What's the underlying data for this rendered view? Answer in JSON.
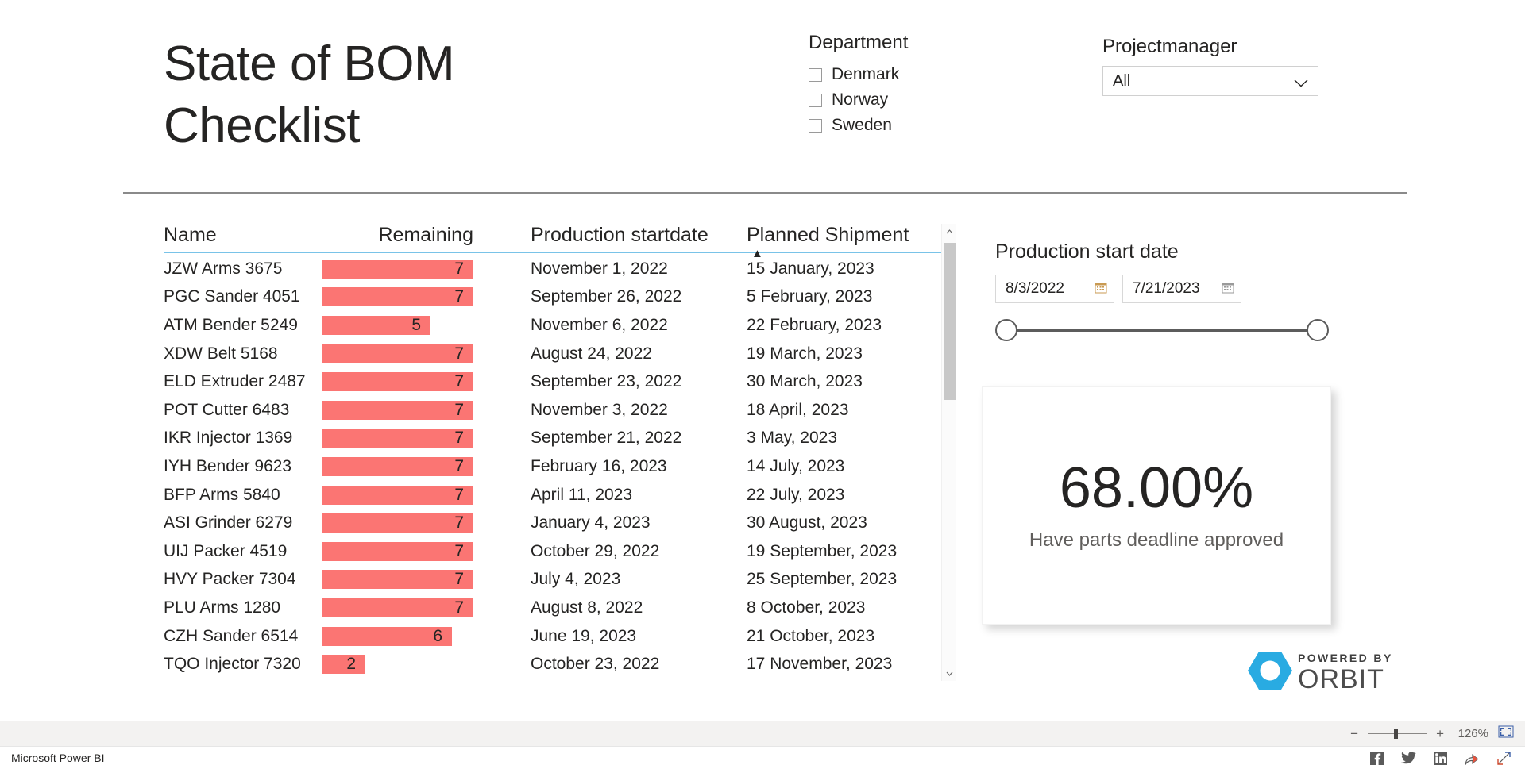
{
  "page_title": "State of BOM\nChecklist",
  "department_slicer": {
    "title": "Department",
    "options": [
      {
        "label": "Denmark",
        "checked": false
      },
      {
        "label": "Norway",
        "checked": false
      },
      {
        "label": "Sweden",
        "checked": false
      }
    ]
  },
  "projectmanager_slicer": {
    "title": "Projectmanager",
    "selected": "All",
    "icon": "chevron-down-icon"
  },
  "table": {
    "columns": [
      "Name",
      "Remaining",
      "Production startdate",
      "Planned Shipment"
    ],
    "sorted_column": "Planned Shipment",
    "sort_direction": "ascending",
    "sort_glyph": "▲",
    "bar_color": "#fb7573",
    "header_rule_color": "#79c3e8",
    "max_remaining": 7,
    "rows": [
      {
        "name": "JZW Arms 3675",
        "remaining": 7,
        "start": "November 1, 2022",
        "shipment": "15 January, 2023"
      },
      {
        "name": "PGC Sander 4051",
        "remaining": 7,
        "start": "September 26, 2022",
        "shipment": "5 February, 2023"
      },
      {
        "name": "ATM Bender 5249",
        "remaining": 5,
        "start": "November 6, 2022",
        "shipment": "22 February, 2023"
      },
      {
        "name": "XDW Belt 5168",
        "remaining": 7,
        "start": "August 24, 2022",
        "shipment": "19 March, 2023"
      },
      {
        "name": "ELD Extruder 2487",
        "remaining": 7,
        "start": "September 23, 2022",
        "shipment": "30 March, 2023"
      },
      {
        "name": "POT Cutter 6483",
        "remaining": 7,
        "start": "November 3, 2022",
        "shipment": "18 April, 2023"
      },
      {
        "name": "IKR Injector 1369",
        "remaining": 7,
        "start": "September 21, 2022",
        "shipment": "3 May, 2023"
      },
      {
        "name": "IYH Bender 9623",
        "remaining": 7,
        "start": "February 16, 2023",
        "shipment": "14 July, 2023"
      },
      {
        "name": "BFP Arms 5840",
        "remaining": 7,
        "start": "April 11, 2023",
        "shipment": "22 July, 2023"
      },
      {
        "name": "ASI Grinder 6279",
        "remaining": 7,
        "start": "January 4, 2023",
        "shipment": "30 August, 2023"
      },
      {
        "name": "UIJ Packer 4519",
        "remaining": 7,
        "start": "October 29, 2022",
        "shipment": "19 September, 2023"
      },
      {
        "name": "HVY Packer 7304",
        "remaining": 7,
        "start": "July 4, 2023",
        "shipment": "25 September, 2023"
      },
      {
        "name": "PLU Arms 1280",
        "remaining": 7,
        "start": "August 8, 2022",
        "shipment": "8 October, 2023"
      },
      {
        "name": "CZH Sander 6514",
        "remaining": 6,
        "start": "June 19, 2023",
        "shipment": "21 October, 2023"
      },
      {
        "name": "TQO Injector 7320",
        "remaining": 2,
        "start": "October 23, 2022",
        "shipment": "17 November, 2023"
      }
    ]
  },
  "date_slicer": {
    "title": "Production start date",
    "start_date": "8/3/2022",
    "end_date": "7/21/2023",
    "icon": "calendar-icon"
  },
  "kpi_card": {
    "value": "68.00%",
    "label": "Have parts deadline approved"
  },
  "orbit_logo": {
    "powered_by": "POWERED BY",
    "name": "ORBIT",
    "mark_color": "#29abe2"
  },
  "zoom_control": {
    "minus": "−",
    "plus": "+",
    "level": "126%",
    "fit_icon": "fit-to-page-icon"
  },
  "status_bar": {
    "brand": "Microsoft Power BI",
    "actions": [
      "facebook-icon",
      "twitter-icon",
      "linkedin-icon",
      "share-icon",
      "fullscreen-icon"
    ]
  }
}
